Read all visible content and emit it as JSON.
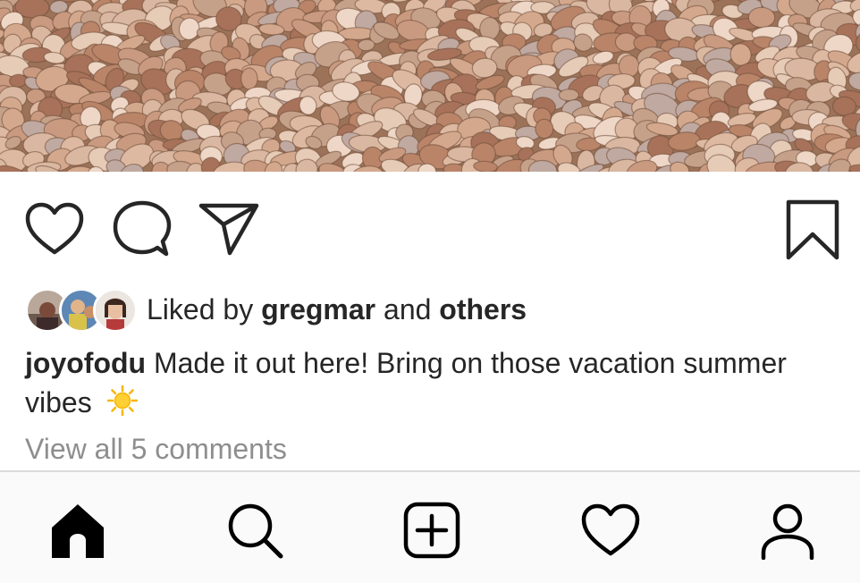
{
  "post": {
    "image_description_icon": "pebbles-photo"
  },
  "actions": {
    "like_icon": "heart-outline-icon",
    "comment_icon": "comment-bubble-icon",
    "share_icon": "paper-plane-icon",
    "save_icon": "bookmark-icon"
  },
  "likes": {
    "prefix": "Liked by",
    "user": "gregmar",
    "joiner": "and",
    "others": "others"
  },
  "caption": {
    "username": "joyofodu",
    "text": "Made it out here! Bring on those vacation summer vibes",
    "emoji": "sun-emoji"
  },
  "comments": {
    "view_all_label": "View all 5 comments"
  },
  "bottom_nav": {
    "items": [
      {
        "icon": "home-icon",
        "active": true
      },
      {
        "icon": "search-icon",
        "active": false
      },
      {
        "icon": "add-post-icon",
        "active": false
      },
      {
        "icon": "activity-heart-icon",
        "active": false
      },
      {
        "icon": "profile-icon",
        "active": false
      }
    ]
  },
  "colors": {
    "text_primary": "#262626",
    "text_secondary": "#8e8e8e",
    "nav_background": "#fafafa",
    "divider": "#dbdbdb",
    "sun_emoji": "#f7b500"
  }
}
